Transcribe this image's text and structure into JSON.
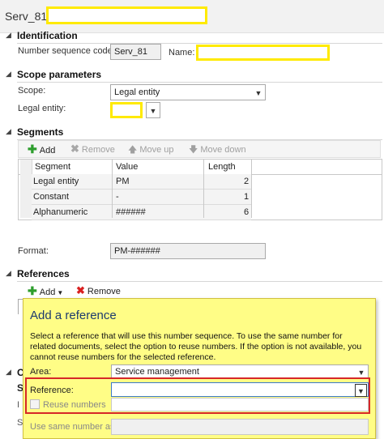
{
  "title": {
    "text": "Serv_81 :",
    "field_value": ""
  },
  "sections": {
    "identification": "Identification",
    "scope": "Scope parameters",
    "segments": "Segments",
    "references": "References"
  },
  "identification": {
    "number_sequence_code_label": "Number sequence code:",
    "number_sequence_code_value": "Serv_81",
    "name_label": "Name:",
    "name_value": ""
  },
  "scope": {
    "scope_label": "Scope:",
    "scope_value": "Legal entity",
    "legal_entity_label": "Legal entity:",
    "legal_entity_value": ""
  },
  "segments_toolbar": {
    "add": "Add",
    "remove": "Remove",
    "move_up": "Move up",
    "move_down": "Move down"
  },
  "segments_grid": {
    "headers": [
      "Segment",
      "Value",
      "Length"
    ],
    "rows": [
      {
        "segment": "Legal entity",
        "value": "PM",
        "length": "2"
      },
      {
        "segment": "Constant",
        "value": "-",
        "length": "1"
      },
      {
        "segment": "Alphanumeric",
        "value": "######",
        "length": "6"
      }
    ]
  },
  "format": {
    "label": "Format:",
    "value": "PM-######"
  },
  "references_toolbar": {
    "add": "Add",
    "remove": "Remove"
  },
  "popup": {
    "title": "Add a reference",
    "description": "Select a reference that will use this number sequence. To use the same number for related documents, select the option to reuse numbers. If the option is not available, you cannot reuse numbers for the selected reference.",
    "area_label": "Area:",
    "area_value": "Service management",
    "reference_label": "Reference:",
    "reference_value": "",
    "reuse_label": "Reuse numbers",
    "use_same_label": "Use same number as:",
    "use_same_value": ""
  },
  "background_letters": {
    "c": "C",
    "s1": "S",
    "i": "I",
    "s2": "S"
  }
}
